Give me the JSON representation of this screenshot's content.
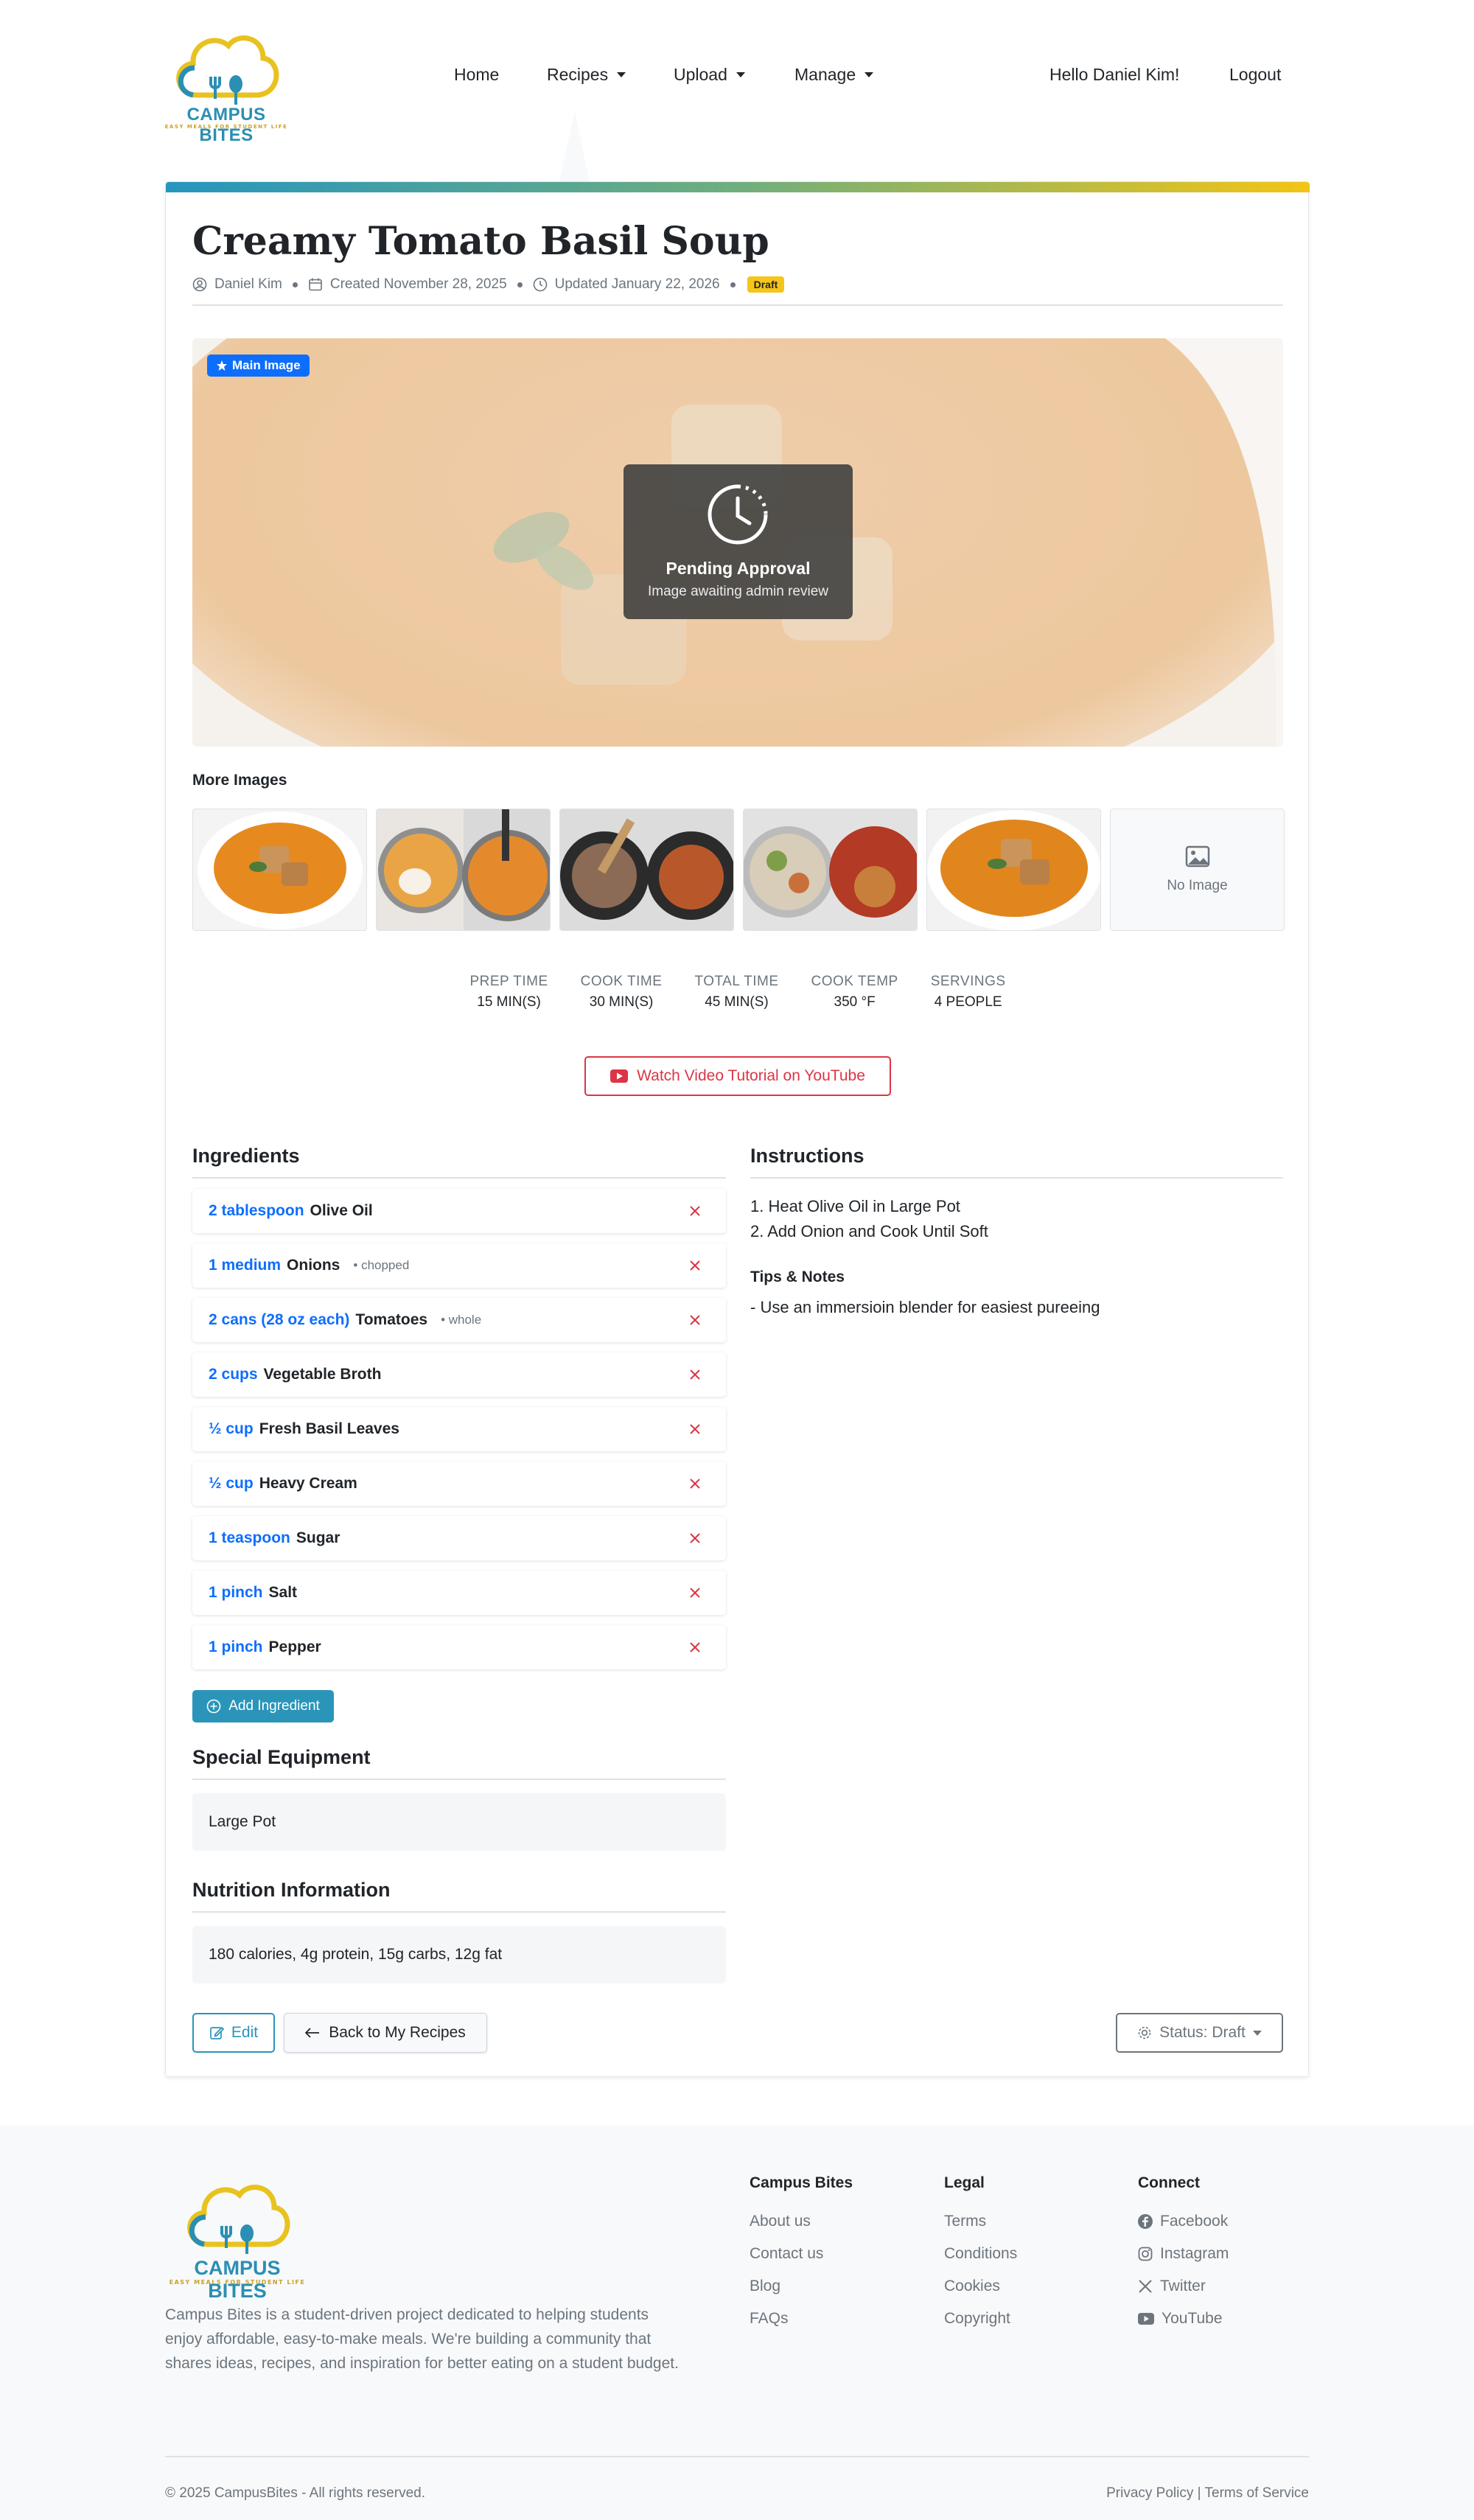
{
  "brand": {
    "name": "CAMPUS BITES",
    "tagline": "EASY MEALS FOR STUDENT LIFE"
  },
  "nav": {
    "home": "Home",
    "recipes": "Recipes",
    "upload": "Upload",
    "manage": "Manage",
    "greeting": "Hello Daniel Kim!",
    "logout": "Logout"
  },
  "recipe": {
    "title": "Creamy Tomato Basil Soup",
    "author": "Daniel Kim",
    "created": "Created November 28, 2025",
    "updated": "Updated January 22, 2026",
    "status_badge": "Draft",
    "main_image_badge": "Main Image",
    "pending_title": "Pending Approval",
    "pending_sub": "Image awaiting admin review",
    "more_images_label": "More Images",
    "no_image": "No Image",
    "stats": [
      {
        "label": "PREP TIME",
        "value": "15 MIN(S)"
      },
      {
        "label": "COOK TIME",
        "value": "30 MIN(S)"
      },
      {
        "label": "TOTAL TIME",
        "value": "45 MIN(S)"
      },
      {
        "label": "COOK TEMP",
        "value": "350 °F"
      },
      {
        "label": "SERVINGS",
        "value": "4 PEOPLE"
      }
    ],
    "youtube_label": "Watch Video Tutorial on YouTube",
    "ingredients_heading": "Ingredients",
    "ingredients": [
      {
        "qty": "2 tablespoon",
        "name": "Olive Oil",
        "note": ""
      },
      {
        "qty": "1 medium",
        "name": "Onions",
        "note": "chopped"
      },
      {
        "qty": "2 cans (28 oz each)",
        "name": "Tomatoes",
        "note": "whole"
      },
      {
        "qty": "2 cups",
        "name": "Vegetable Broth",
        "note": ""
      },
      {
        "qty": "½ cup",
        "name": "Fresh Basil Leaves",
        "note": ""
      },
      {
        "qty": "½ cup",
        "name": "Heavy Cream",
        "note": ""
      },
      {
        "qty": "1 teaspoon",
        "name": "Sugar",
        "note": ""
      },
      {
        "qty": "1 pinch",
        "name": "Salt",
        "note": ""
      },
      {
        "qty": "1 pinch",
        "name": "Pepper",
        "note": ""
      }
    ],
    "add_ingredient": "Add Ingredient",
    "equipment_heading": "Special Equipment",
    "equipment": "Large Pot",
    "nutrition_heading": "Nutrition Information",
    "nutrition": "180 calories, 4g protein, 15g carbs, 12g fat",
    "instructions_heading": "Instructions",
    "instructions": [
      "1. Heat Olive Oil in Large Pot",
      "2. Add Onion and Cook Until Soft"
    ],
    "tips_heading": "Tips & Notes",
    "tips": "- Use an immersioin blender for easiest pureeing",
    "edit": "Edit",
    "back": "Back to My Recipes",
    "status": "Status: Draft"
  },
  "footer": {
    "description": "Campus Bites is a student-driven project dedicated to helping students enjoy affordable, easy-to-make meals. We're building a community that shares ideas, recipes, and inspiration for better eating on a student budget.",
    "col1": {
      "heading": "Campus Bites",
      "links": [
        "About us",
        "Contact us",
        "Blog",
        "FAQs"
      ]
    },
    "col2": {
      "heading": "Legal",
      "links": [
        "Terms",
        "Conditions",
        "Cookies",
        "Copyright"
      ]
    },
    "col3": {
      "heading": "Connect",
      "links": [
        "Facebook",
        "Instagram",
        "Twitter",
        "YouTube"
      ]
    },
    "copyright": "© 2025 CampusBites - All rights reserved.",
    "privacy": "Privacy Policy",
    "separator": "|",
    "terms_of_service": "Terms of Service"
  },
  "colors": {
    "accent": "#2a95b9",
    "primary": "#0d6efd",
    "danger": "#dc3545",
    "draft_badge": "#f5c518"
  }
}
